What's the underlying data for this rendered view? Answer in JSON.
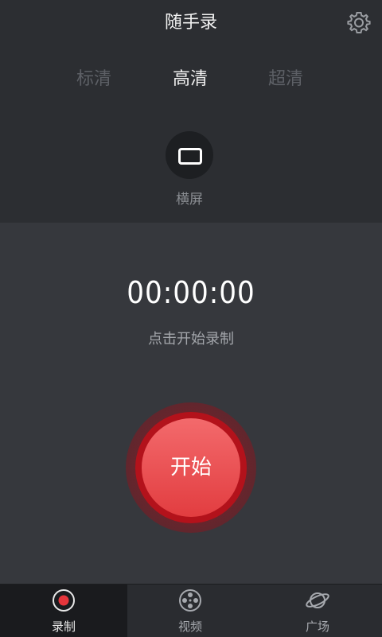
{
  "header": {
    "title": "随手录"
  },
  "quality": {
    "options": [
      "标清",
      "高清",
      "超清"
    ],
    "selected": "高清"
  },
  "orientation": {
    "label": "横屏"
  },
  "recorder": {
    "timer": "00:00:00",
    "hint": "点击开始录制",
    "start_label": "开始"
  },
  "tabs": [
    {
      "label": "录制",
      "icon": "record-icon",
      "active": true
    },
    {
      "label": "视频",
      "icon": "film-reel-icon",
      "active": false
    },
    {
      "label": "广场",
      "icon": "planet-icon",
      "active": false
    }
  ],
  "colors": {
    "accent": "#e23d40",
    "background": "#36383d",
    "header_bg": "#2c2e32"
  }
}
